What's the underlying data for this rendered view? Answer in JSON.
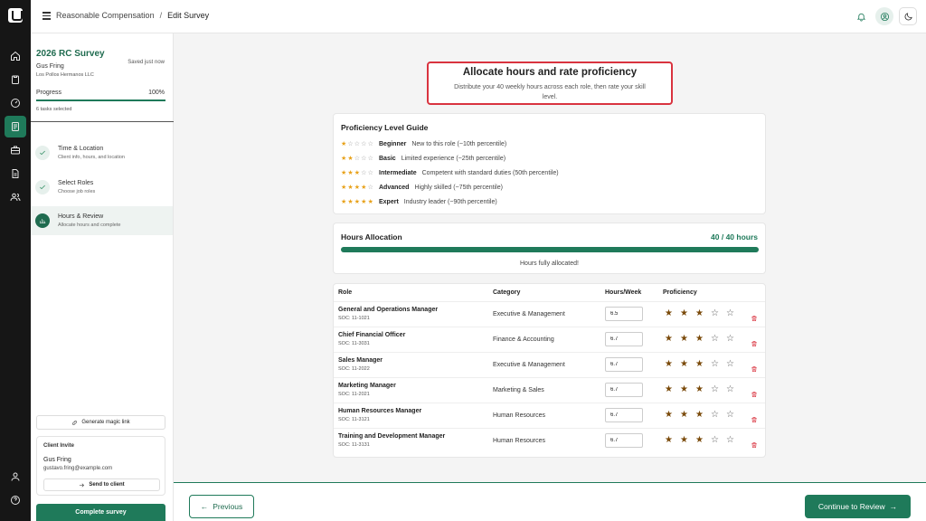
{
  "header": {
    "breadcrumb_root": "Reasonable Compensation",
    "breadcrumb_sep": "/",
    "breadcrumb_current": "Edit Survey"
  },
  "sidebar": {
    "survey_title": "2026 RC Survey",
    "saved_status": "Saved just now",
    "client_name": "Gus Fring",
    "company": "Los Pollos Hermanos LLC",
    "progress_label": "Progress",
    "progress_value": "100%",
    "progress_fraction": 1.0,
    "tasks_selected": "6 tasks selected",
    "steps": [
      {
        "title": "Time & Location",
        "subtitle": "Client info, hours, and location",
        "state": "done"
      },
      {
        "title": "Select Roles",
        "subtitle": "Choose job roles",
        "state": "done"
      },
      {
        "title": "Hours & Review",
        "subtitle": "Allocate hours and complete",
        "state": "active"
      }
    ],
    "magic_link_label": "Generate magic link",
    "invite": {
      "heading": "Client Invite",
      "name": "Gus Fring",
      "email": "gustavo.fring@example.com",
      "send_label": "Send to client"
    },
    "complete_label": "Complete survey"
  },
  "main": {
    "heading": "Allocate hours and rate proficiency",
    "subheading": "Distribute your 40 weekly hours across each role, then rate your skill level.",
    "guide": {
      "title": "Proficiency Level Guide",
      "levels": [
        {
          "stars": 1,
          "name": "Beginner",
          "desc": "New to this role (~10th percentile)"
        },
        {
          "stars": 2,
          "name": "Basic",
          "desc": "Limited experience (~25th percentile)"
        },
        {
          "stars": 3,
          "name": "Intermediate",
          "desc": "Competent with standard duties (50th percentile)"
        },
        {
          "stars": 4,
          "name": "Advanced",
          "desc": "Highly skilled (~75th percentile)"
        },
        {
          "stars": 5,
          "name": "Expert",
          "desc": "Industry leader (~90th percentile)"
        }
      ]
    },
    "hours": {
      "label": "Hours Allocation",
      "value": "40 / 40 hours",
      "fraction": 1.0,
      "message": "Hours fully allocated!"
    },
    "table": {
      "columns": [
        "Role",
        "Category",
        "Hours/Week",
        "Proficiency"
      ],
      "rows": [
        {
          "role": "General and Operations Manager",
          "soc": "SOC: 11-1021",
          "category": "Executive & Management",
          "hours": "6.5",
          "rating": 3
        },
        {
          "role": "Chief Financial Officer",
          "soc": "SOC: 11-3031",
          "category": "Finance & Accounting",
          "hours": "6.7",
          "rating": 3
        },
        {
          "role": "Sales Manager",
          "soc": "SOC: 11-2022",
          "category": "Executive & Management",
          "hours": "6.7",
          "rating": 3
        },
        {
          "role": "Marketing Manager",
          "soc": "SOC: 11-2021",
          "category": "Marketing & Sales",
          "hours": "6.7",
          "rating": 3
        },
        {
          "role": "Human Resources Manager",
          "soc": "SOC: 11-3121",
          "category": "Human Resources",
          "hours": "6.7",
          "rating": 3
        },
        {
          "role": "Training and Development Manager",
          "soc": "SOC: 11-3131",
          "category": "Human Resources",
          "hours": "6.7",
          "rating": 3
        }
      ]
    }
  },
  "footer": {
    "previous_label": "Previous",
    "next_label": "Continue to Review"
  },
  "colors": {
    "brand": "#1f7a5a",
    "highlight": "#d9333f",
    "star": "#e8a21b"
  }
}
